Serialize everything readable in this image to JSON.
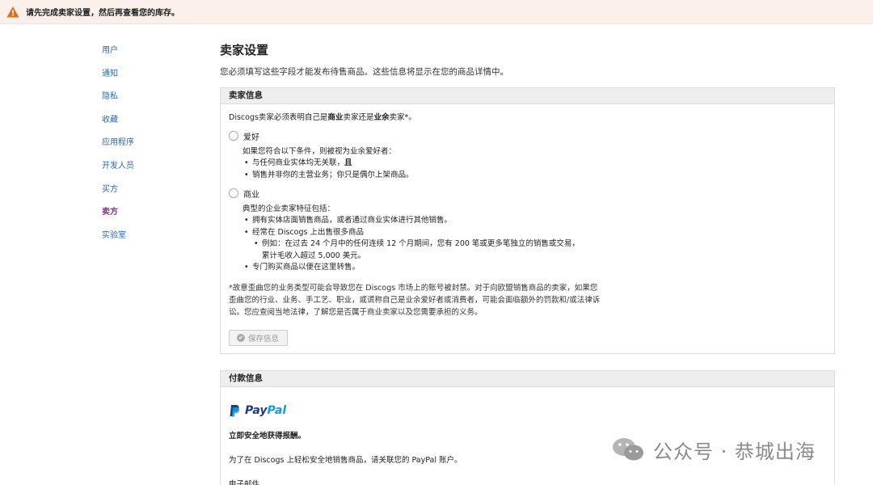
{
  "alert": {
    "icon": "warning-icon",
    "text": "请先完成卖家设置，然后再查看您的库存。",
    "color": "#e36b1f"
  },
  "sidebar": {
    "items": [
      {
        "label": "用户"
      },
      {
        "label": "通知"
      },
      {
        "label": "隐私"
      },
      {
        "label": "收藏"
      },
      {
        "label": "应用程序"
      },
      {
        "label": "开发人员"
      },
      {
        "label": "买方"
      },
      {
        "label": "卖方",
        "active": true
      },
      {
        "label": "实验室"
      }
    ]
  },
  "main": {
    "title": "卖家设置",
    "description": "您必须填写这些字段才能发布待售商品。这些信息将显示在您的商品详情中。"
  },
  "seller_info": {
    "heading": "卖家信息",
    "intro_pre": "Discogs卖家必须表明自己是",
    "intro_bold1": "商业",
    "intro_mid": "卖家还是",
    "intro_bold2": "业余",
    "intro_post": "卖家*。",
    "hobby": {
      "label": "爱好",
      "hint": "如果您符合以下条件，则被视为业余爱好者：",
      "bullet1_pre": "与任何商业实体均无关联，",
      "bullet1_bold": "且",
      "bullet2": "销售并非你的主营业务；你只是偶尔上架商品。"
    },
    "business": {
      "label": "商业",
      "hint": "典型的企业卖家特征包括：",
      "bullet1": "拥有实体店面销售商品，或者通过商业实体进行其他销售。",
      "bullet2": "经常在 Discogs 上出售很多商品",
      "sub1_line1": "例如：在过去 24 个月中的任何连续 12 个月期间，您有 200 笔或更多笔独立的销售或交易，",
      "sub1_line2": "累计毛收入超过 5,000 美元。",
      "bullet3": "专门购买商品以便在这里转售。"
    },
    "warning": "*故意歪曲您的业务类型可能会导致您在 Discogs 市场上的账号被封禁。对于向欧盟销售商品的卖家，如果您歪曲您的行业、业务、手工艺、职业，或谎称自己是业余爱好者或消费者，可能会面临额外的罚款和/或法律诉讼。您应查阅当地法律，了解您是否属于商业卖家以及您需要承担的义务。",
    "save_label": "保存信息"
  },
  "payment": {
    "heading": "付款信息",
    "logo_text_pay": "Pay",
    "logo_text_pal": "Pal",
    "title": "立即安全地获得报酬。",
    "description": "为了在 Discogs 上轻松安全地销售商品，请关联您的 PayPal 账户。",
    "email_label": "电子邮件"
  },
  "watermark": {
    "text": "公众号 · 恭城出海"
  }
}
